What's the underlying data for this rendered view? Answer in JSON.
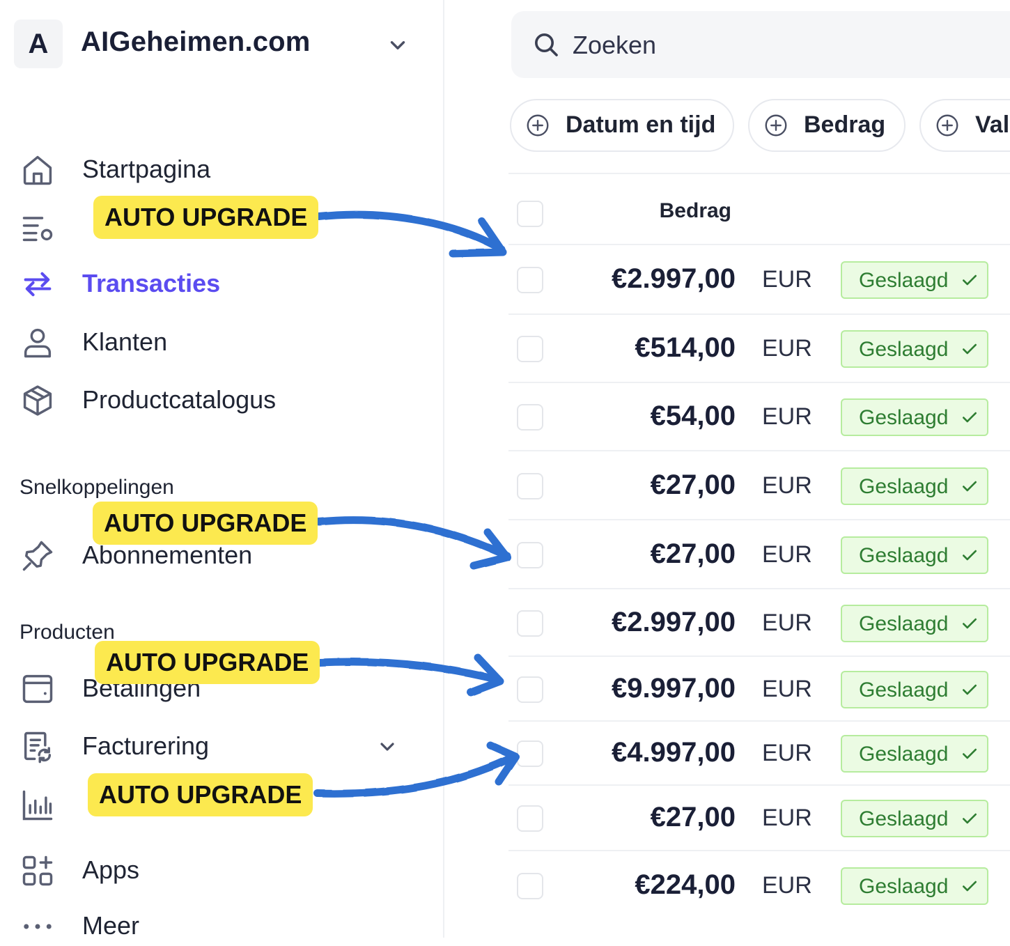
{
  "account": {
    "initial": "A",
    "name": "AIGeheimen.com"
  },
  "nav": {
    "home": "Startpagina",
    "transactions": "Transacties",
    "customers": "Klanten",
    "catalog": "Productcatalogus",
    "subscriptions": "Abonnementen",
    "payments": "Betalingen",
    "billing": "Facturering",
    "apps": "Apps",
    "more": "Meer"
  },
  "sections": {
    "shortcuts": "Snelkoppelingen",
    "products": "Producten"
  },
  "badge_text": "AUTO UPGRADE",
  "search": {
    "placeholder": "Zoeken"
  },
  "filters": [
    "Datum en tijd",
    "Bedrag",
    "Val"
  ],
  "table": {
    "header_amount": "Bedrag",
    "rows": [
      {
        "amount": "€2.997,00",
        "currency": "EUR",
        "status": "Geslaagd"
      },
      {
        "amount": "€514,00",
        "currency": "EUR",
        "status": "Geslaagd"
      },
      {
        "amount": "€54,00",
        "currency": "EUR",
        "status": "Geslaagd"
      },
      {
        "amount": "€27,00",
        "currency": "EUR",
        "status": "Geslaagd"
      },
      {
        "amount": "€27,00",
        "currency": "EUR",
        "status": "Geslaagd"
      },
      {
        "amount": "€2.997,00",
        "currency": "EUR",
        "status": "Geslaagd"
      },
      {
        "amount": "€9.997,00",
        "currency": "EUR",
        "status": "Geslaagd"
      },
      {
        "amount": "€4.997,00",
        "currency": "EUR",
        "status": "Geslaagd"
      },
      {
        "amount": "€27,00",
        "currency": "EUR",
        "status": "Geslaagd"
      },
      {
        "amount": "€224,00",
        "currency": "EUR",
        "status": "Geslaagd"
      }
    ]
  },
  "colors": {
    "accent": "#5b4cf0",
    "badge": "#fce94f",
    "arrow": "#2f6fd1",
    "success_bg": "#ebfbe3",
    "success_border": "#b6ec9e",
    "success_text": "#2e7d32"
  }
}
